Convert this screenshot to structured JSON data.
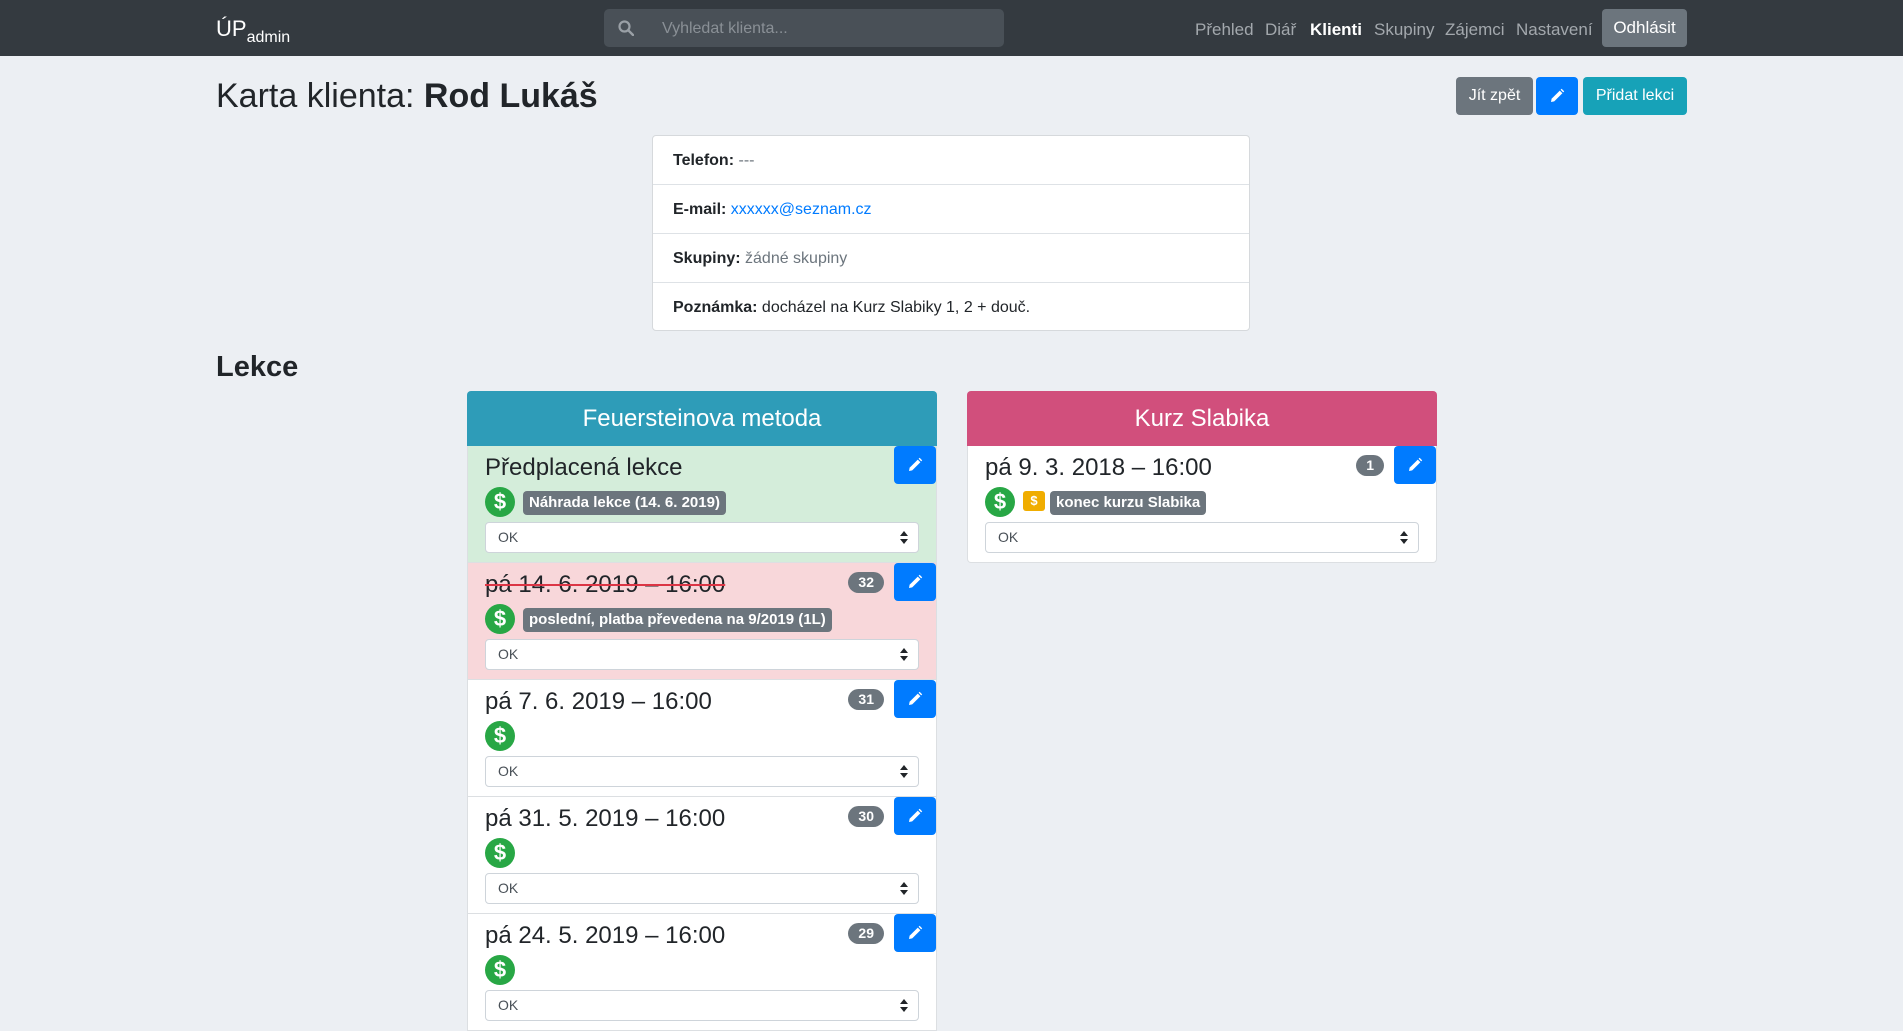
{
  "navbar": {
    "brand_main": "ÚP",
    "brand_sub": "admin",
    "search_placeholder": "Vyhledat klienta...",
    "links": [
      "Přehled",
      "Diář",
      "Klienti",
      "Skupiny",
      "Zájemci",
      "Nastavení"
    ],
    "active_link": "Klienti",
    "logout_label": "Odhlásit"
  },
  "header": {
    "title_prefix": "Karta klienta:",
    "client_name": "Rod Lukáš",
    "back_label": "Jít zpět",
    "add_lesson_label": "Přidat lekci"
  },
  "info": {
    "phone_label": "Telefon:",
    "phone_value": "---",
    "email_label": "E-mail:",
    "email_value": "xxxxxx@seznam.cz",
    "groups_label": "Skupiny:",
    "groups_value": "žádné skupiny",
    "note_label": "Poznámka:",
    "note_value": "docházel na Kurz Slabiky 1, 2 + douč."
  },
  "lessons_title": "Lekce",
  "courses": [
    {
      "name": "Feuersteinova metoda",
      "color": "#2e9cb8",
      "lessons": [
        {
          "title": "Předplacená lekce",
          "count": "",
          "tag": "Náhrada lekce (14. 6. 2019)",
          "status": "OK",
          "bg": "#d4edda",
          "canceled": false
        },
        {
          "title": "pá 14. 6. 2019 – 16:00",
          "count": "32",
          "tag": "poslední, platba převedena na 9/2019 (1L)",
          "status": "OK",
          "bg": "#f8d7da",
          "canceled": true
        },
        {
          "title": "pá 7. 6. 2019 – 16:00",
          "count": "31",
          "tag": "",
          "status": "OK",
          "bg": "#ffffff",
          "canceled": false
        },
        {
          "title": "pá 31. 5. 2019 – 16:00",
          "count": "30",
          "tag": "",
          "status": "OK",
          "bg": "#ffffff",
          "canceled": false
        },
        {
          "title": "pá 24. 5. 2019 – 16:00",
          "count": "29",
          "tag": "",
          "status": "OK",
          "bg": "#ffffff",
          "canceled": false
        }
      ]
    },
    {
      "name": "Kurz Slabika",
      "color": "#d14f7c",
      "lessons": [
        {
          "title": "pá 9. 3. 2018 – 16:00",
          "count": "1",
          "tag": "konec kurzu Slabika",
          "status": "OK",
          "bg": "#ffffff",
          "canceled": false,
          "note_icon": true
        }
      ]
    }
  ],
  "icons": {
    "search": "search-icon",
    "edit": "pencil-icon",
    "paid": "dollar-icon",
    "note": "note-dollar-icon",
    "select": "select-arrows-icon"
  }
}
